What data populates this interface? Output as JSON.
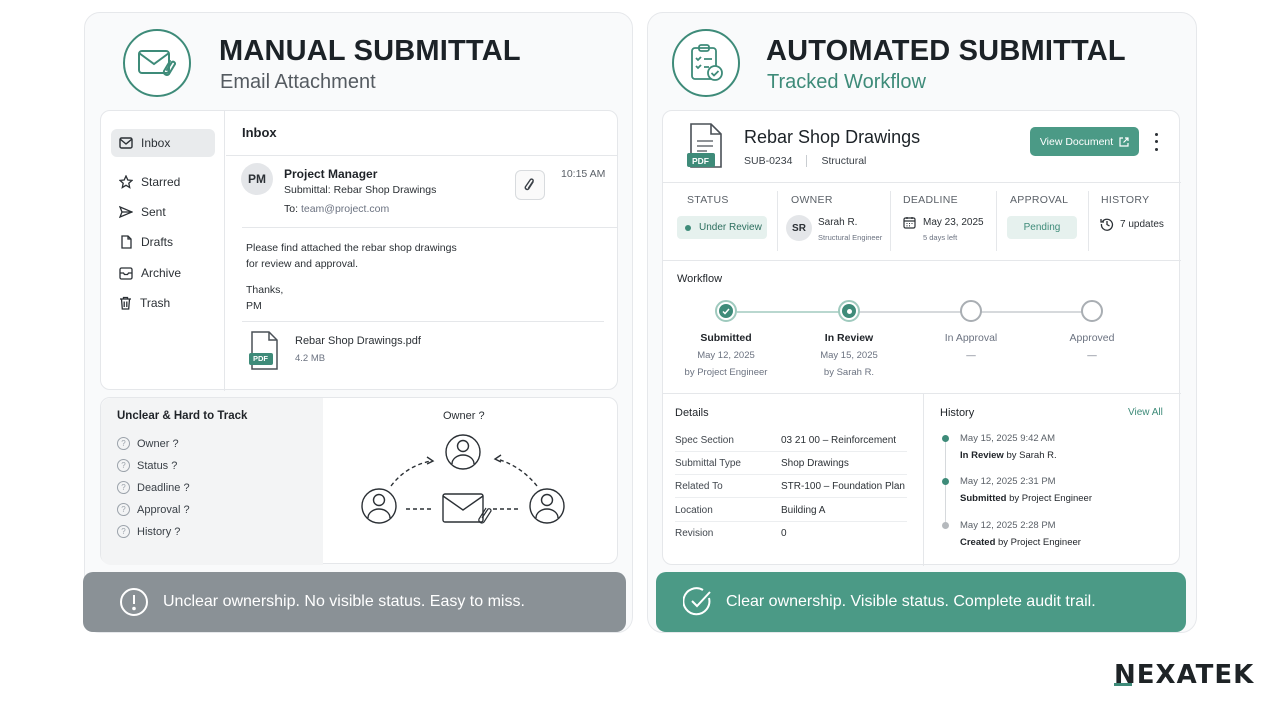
{
  "manual": {
    "title": "MANUAL SUBMITTAL",
    "subtitle": "Email Attachment",
    "sidebar": [
      "Inbox",
      "Starred",
      "Sent",
      "Drafts",
      "Archive",
      "Trash"
    ],
    "inbox_heading": "Inbox",
    "email": {
      "avatar": "PM",
      "from": "Project Manager",
      "subject": "Submittal: Rebar Shop Drawings",
      "to_label": "To:",
      "to": "team@project.com",
      "time": "10:15 AM",
      "body_line1": "Please find attached the rebar shop drawings",
      "body_line2": "for review and approval.",
      "signoff1": "Thanks,",
      "signoff2": "PM",
      "attachment_name": "Rebar Shop Drawings.pdf",
      "attachment_size": "4.2 MB",
      "pdf_badge": "PDF"
    },
    "unclear_heading": "Unclear & Hard to Track",
    "unclear_items": [
      "Owner ?",
      "Status ?",
      "Deadline ?",
      "Approval ?",
      "History ?"
    ],
    "diagram_owner_label": "Owner ?",
    "banner": "Unclear ownership. No visible status. Easy to miss."
  },
  "automated": {
    "title": "AUTOMATED SUBMITTAL",
    "subtitle": "Tracked Workflow",
    "doc": {
      "title": "Rebar Shop Drawings",
      "id": "SUB-0234",
      "category": "Structural",
      "view_button": "View Document",
      "pdf_badge": "PDF"
    },
    "status_cols": {
      "status_h": "STATUS",
      "status_v": "Under Review",
      "owner_h": "OWNER",
      "owner_avatar": "SR",
      "owner_name": "Sarah R.",
      "owner_role": "Structural Engineer",
      "deadline_h": "DEADLINE",
      "deadline_date": "May 23, 2025",
      "deadline_left": "5 days left",
      "approval_h": "APPROVAL",
      "approval_v": "Pending",
      "history_h": "HISTORY",
      "history_v": "7 updates"
    },
    "workflow_heading": "Workflow",
    "steps": [
      {
        "label": "Submitted",
        "date": "May 12, 2025",
        "by": "by Project Engineer"
      },
      {
        "label": "In Review",
        "date": "May 15, 2025",
        "by": "by Sarah R."
      },
      {
        "label": "In Approval",
        "date": "—",
        "by": ""
      },
      {
        "label": "Approved",
        "date": "—",
        "by": ""
      }
    ],
    "details_heading": "Details",
    "details": [
      {
        "k": "Spec Section",
        "v": "03 21 00 – Reinforcement"
      },
      {
        "k": "Submittal Type",
        "v": "Shop Drawings"
      },
      {
        "k": "Related To",
        "v": "STR-100 – Foundation Plan"
      },
      {
        "k": "Location",
        "v": "Building A"
      },
      {
        "k": "Revision",
        "v": "0"
      }
    ],
    "history_heading": "History",
    "history_view_all": "View All",
    "history": [
      {
        "when": "May 15, 2025  9:42 AM",
        "what_b": "In Review",
        "what": " by Sarah R."
      },
      {
        "when": "May 12, 2025  2:31 PM",
        "what_b": "Submitted",
        "what": " by Project Engineer"
      },
      {
        "when": "May 12, 2025  2:28 PM",
        "what_b": "Created",
        "what": " by Project Engineer"
      }
    ],
    "banner": "Clear ownership. Visible status. Complete audit trail."
  },
  "brand": "NEXATEK",
  "colors": {
    "accent": "#3e8b79",
    "gray_banner": "#8a9196",
    "green_banner": "#4b9a86"
  }
}
